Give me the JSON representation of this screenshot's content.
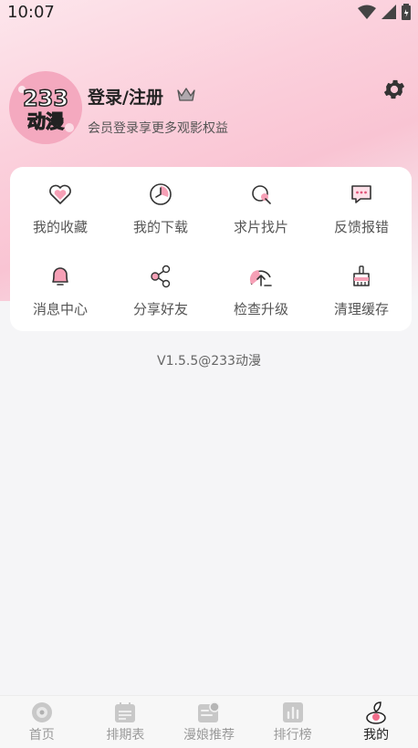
{
  "status": {
    "time": "10:07"
  },
  "avatar": {
    "logo_text_top": "233",
    "logo_text_bottom": "动漫"
  },
  "profile": {
    "title": "登录/注册",
    "subtitle": "会员登录享更多观影权益"
  },
  "menu": [
    {
      "label": "我的收藏",
      "icon": "heart-icon"
    },
    {
      "label": "我的下载",
      "icon": "download-clock-icon"
    },
    {
      "label": "求片找片",
      "icon": "search-film-icon"
    },
    {
      "label": "反馈报错",
      "icon": "feedback-icon"
    },
    {
      "label": "消息中心",
      "icon": "bell-icon"
    },
    {
      "label": "分享好友",
      "icon": "share-icon"
    },
    {
      "label": "检查升级",
      "icon": "upgrade-icon"
    },
    {
      "label": "清理缓存",
      "icon": "broom-icon"
    }
  ],
  "version": "V1.5.5@233动漫",
  "tabs": [
    {
      "label": "首页",
      "icon": "home-icon",
      "active": false
    },
    {
      "label": "排期表",
      "icon": "calendar-icon",
      "active": false
    },
    {
      "label": "漫娘推荐",
      "icon": "recommend-icon",
      "active": false
    },
    {
      "label": "排行榜",
      "icon": "ranking-icon",
      "active": false
    },
    {
      "label": "我的",
      "icon": "profile-icon",
      "active": true
    }
  ],
  "colors": {
    "accent": "#f06c8a",
    "pink_light": "#f9c4d3",
    "icon_stroke": "#333333",
    "inactive": "#9a9a9a"
  }
}
